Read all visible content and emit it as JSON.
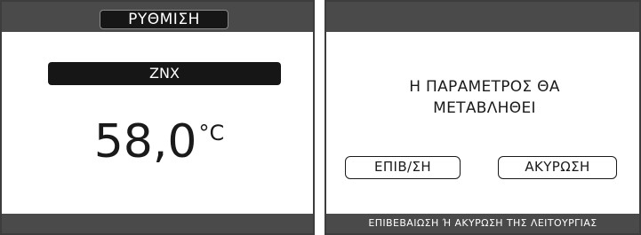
{
  "setting_screen": {
    "title": "ΡΥΘΜΙΣΗ",
    "parameter_name": "ZNX",
    "value": "58,0",
    "unit": "°C"
  },
  "confirm_screen": {
    "message_line1": "Η ΠΑΡΑΜΕΤΡΟΣ ΘΑ",
    "message_line2": "ΜΕΤΑΒΛΗΘΕΙ",
    "confirm_label": "ΕΠΙΒ/ΣΗ",
    "cancel_label": "ΑΚΥΡΩΣΗ",
    "footer_hint": "ΕΠΙΒΕΒΑΙΩΣΗ Ή ΑΚΥΡΩΣΗ ΤΗΣ ΛΕΙΤΟΥΡΓΙΑΣ"
  },
  "colors": {
    "bar": "#4a4a4a",
    "pill": "#161616",
    "background": "#ffffff",
    "text": "#1a1a1a"
  }
}
